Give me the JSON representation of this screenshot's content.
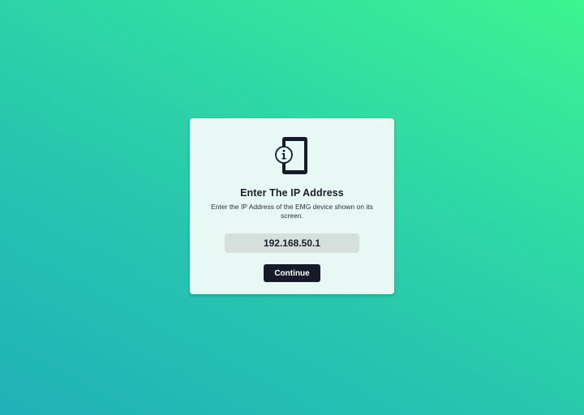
{
  "dialog": {
    "icon": "phone-info-icon",
    "title": "Enter The IP Address",
    "description": "Enter the IP Address of the EMG device shown on its screen.",
    "ip_value": "192.168.50.1",
    "continue_label": "Continue"
  },
  "colors": {
    "card_background": "#e8f8f5",
    "input_background": "#d5e0dc",
    "button_background": "#171a2b",
    "text_dark": "#1a1d2a",
    "gradient_start": "#1fb1b8",
    "gradient_end": "#3cf58f"
  }
}
